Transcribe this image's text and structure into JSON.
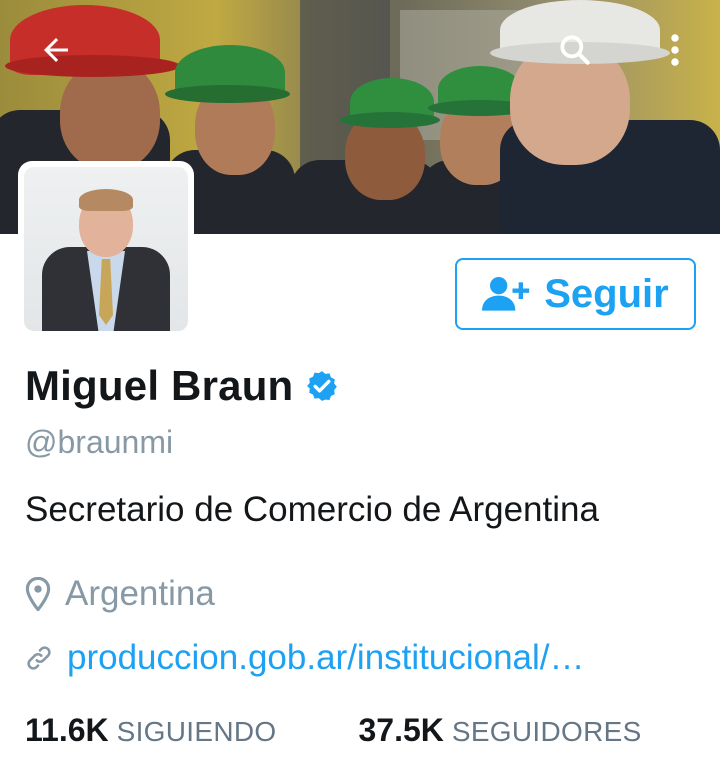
{
  "header": {
    "back_icon": "arrow-left-icon",
    "search_icon": "search-icon",
    "menu_icon": "more-vertical-icon"
  },
  "profile": {
    "name": "Miguel Braun",
    "verified": true,
    "handle": "@braunmi",
    "bio": "Secretario de Comercio de Argentina",
    "location": "Argentina",
    "website": "produccion.gob.ar/institucional/…"
  },
  "follow_button": {
    "label": "Seguir",
    "icon": "add-user-icon"
  },
  "stats": {
    "following_count": "11.6K",
    "following_label": "SIGUIENDO",
    "followers_count": "37.5K",
    "followers_label": "SEGUIDORES"
  },
  "colors": {
    "accent": "#1da1f2",
    "verified_badge": "#1da1f2",
    "muted_text": "#8899a6",
    "primary_text": "#14171a"
  }
}
